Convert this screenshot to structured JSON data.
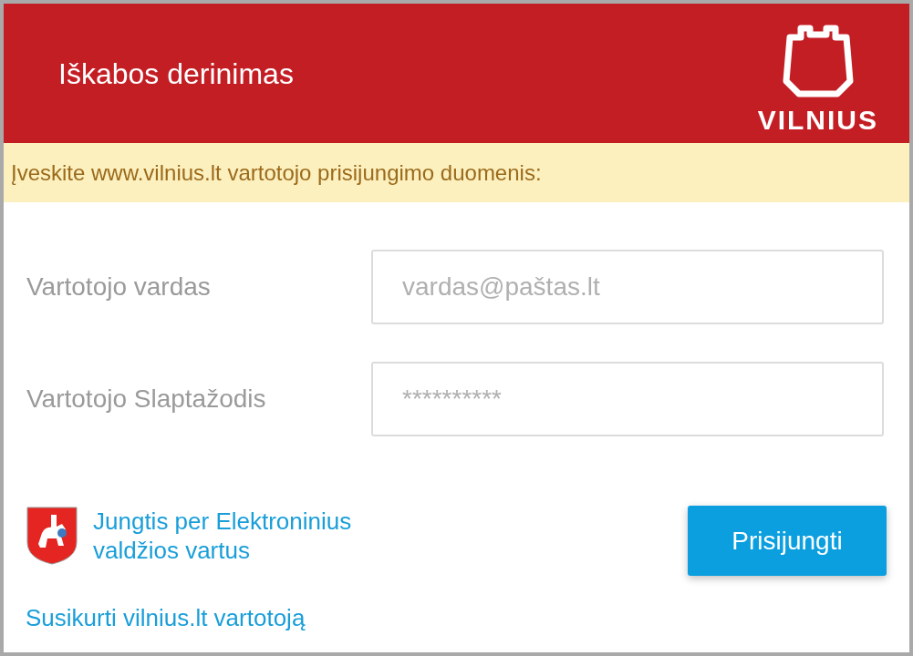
{
  "header": {
    "title": "Iškabos derinimas",
    "logo_text": "VILNIUS"
  },
  "notice": "Įveskite www.vilnius.lt vartotojo prisijungimo duomenis:",
  "fields": [
    {
      "label": "Vartotojo vardas",
      "placeholder": "vardas@paštas.lt"
    },
    {
      "label": "Vartotojo Slaptažodis",
      "placeholder": "**********"
    }
  ],
  "egov_link": "Jungtis per Elektroninius valdžios vartus",
  "login_button": "Prisijungti",
  "register_link": "Susikurti vilnius.lt vartotoją"
}
